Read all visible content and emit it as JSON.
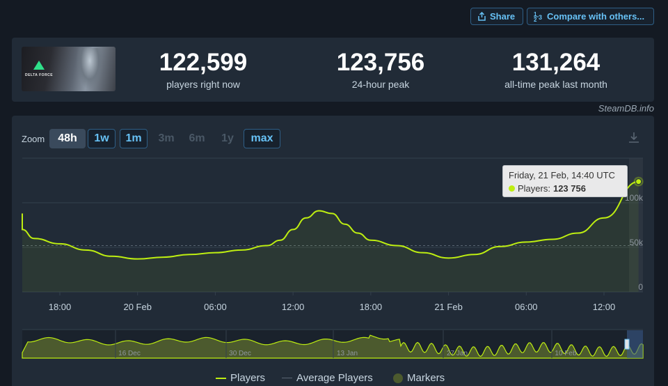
{
  "toolbar": {
    "share_label": "Share",
    "compare_label": "Compare with others..."
  },
  "stats": {
    "current": {
      "value": "122,599",
      "label": "players right now"
    },
    "peak_24h": {
      "value": "123,756",
      "label": "24-hour peak"
    },
    "peak_month": {
      "value": "131,264",
      "label": "all-time peak last month"
    }
  },
  "game": {
    "logo_text": "DELTA FORCE"
  },
  "credit": "SteamDB.info",
  "zoom": {
    "label": "Zoom",
    "buttons": [
      {
        "label": "48h",
        "state": "active"
      },
      {
        "label": "1w",
        "state": "outlined"
      },
      {
        "label": "1m",
        "state": "outlined"
      },
      {
        "label": "3m",
        "state": "disabled"
      },
      {
        "label": "6m",
        "state": "disabled"
      },
      {
        "label": "1y",
        "state": "disabled"
      },
      {
        "label": "max",
        "state": "outlined"
      }
    ]
  },
  "tooltip": {
    "date": "Friday, 21 Feb, 14:40 UTC",
    "series_label": "Players:",
    "value": "123 756"
  },
  "legend": {
    "players": "Players",
    "average": "Average Players",
    "markers": "Markers"
  },
  "colors": {
    "accent": "#67c1f5",
    "series": "#beee11",
    "background": "#141a23",
    "card": "#212b37"
  },
  "chart_data": {
    "type": "line",
    "x_tick_labels": [
      "18:00",
      "20 Feb",
      "06:00",
      "12:00",
      "18:00",
      "21 Feb",
      "06:00",
      "12:00"
    ],
    "y_tick_labels": [
      "0",
      "50k",
      "100k"
    ],
    "ylim": [
      0,
      150000
    ],
    "series": [
      {
        "name": "Players",
        "values": [
          {
            "x": "2025-02-19 13:00",
            "y": 88000
          },
          {
            "x": "2025-02-19 14:30",
            "y": 70000
          },
          {
            "x": "2025-02-19 16:00",
            "y": 60000
          },
          {
            "x": "2025-02-19 18:00",
            "y": 54000
          },
          {
            "x": "2025-02-19 20:00",
            "y": 47000
          },
          {
            "x": "2025-02-19 22:00",
            "y": 40000
          },
          {
            "x": "2025-02-20 00:00",
            "y": 37000
          },
          {
            "x": "2025-02-20 02:00",
            "y": 39000
          },
          {
            "x": "2025-02-20 04:00",
            "y": 42000
          },
          {
            "x": "2025-02-20 06:00",
            "y": 44000
          },
          {
            "x": "2025-02-20 08:00",
            "y": 47000
          },
          {
            "x": "2025-02-20 10:00",
            "y": 52000
          },
          {
            "x": "2025-02-20 11:00",
            "y": 58000
          },
          {
            "x": "2025-02-20 12:00",
            "y": 70000
          },
          {
            "x": "2025-02-20 13:00",
            "y": 83000
          },
          {
            "x": "2025-02-20 14:00",
            "y": 91000
          },
          {
            "x": "2025-02-20 15:00",
            "y": 88000
          },
          {
            "x": "2025-02-20 16:00",
            "y": 76000
          },
          {
            "x": "2025-02-20 17:00",
            "y": 66000
          },
          {
            "x": "2025-02-20 18:00",
            "y": 58000
          },
          {
            "x": "2025-02-20 20:00",
            "y": 52000
          },
          {
            "x": "2025-02-20 22:00",
            "y": 44000
          },
          {
            "x": "2025-02-21 00:00",
            "y": 38000
          },
          {
            "x": "2025-02-21 02:00",
            "y": 42000
          },
          {
            "x": "2025-02-21 04:00",
            "y": 51000
          },
          {
            "x": "2025-02-21 06:00",
            "y": 56000
          },
          {
            "x": "2025-02-21 08:00",
            "y": 59000
          },
          {
            "x": "2025-02-21 10:00",
            "y": 66000
          },
          {
            "x": "2025-02-21 12:00",
            "y": 83000
          },
          {
            "x": "2025-02-21 14:40",
            "y": 123756
          }
        ]
      }
    ],
    "navigator": {
      "x_tick_labels": [
        "16 Dec",
        "30 Dec",
        "13 Jan",
        "27 Jan",
        "10 Feb"
      ]
    }
  }
}
